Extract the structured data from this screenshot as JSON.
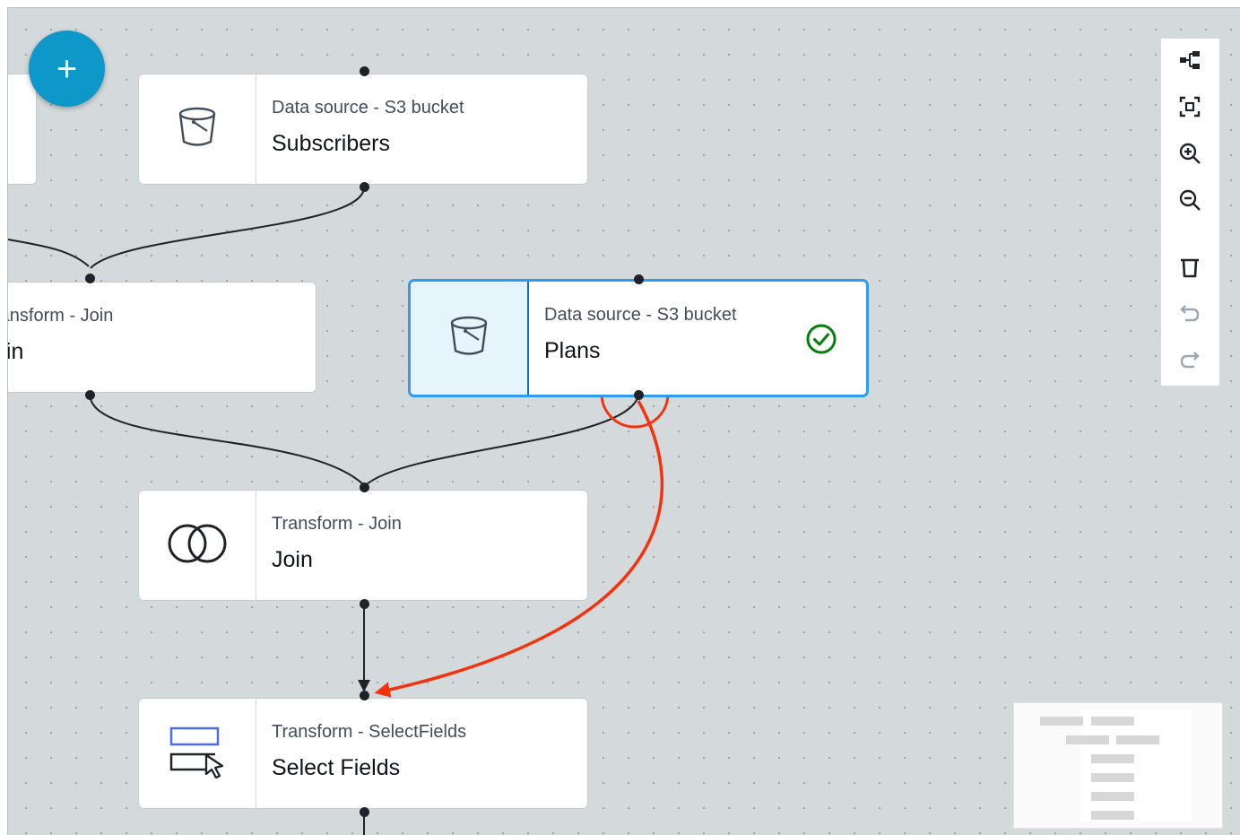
{
  "fab": {
    "label": "+"
  },
  "nodes": [
    {
      "type": "",
      "name": ""
    },
    {
      "type": "Data source - S3 bucket",
      "name": "Subscribers",
      "icon": "bucket-icon"
    },
    {
      "type": "ransform - Join",
      "name": "oin",
      "icon": "join-icon"
    },
    {
      "type": "Data source - S3 bucket",
      "name": "Plans",
      "icon": "bucket-icon",
      "status": "success"
    },
    {
      "type": "Transform - Join",
      "name": "Join",
      "icon": "join-icon"
    },
    {
      "type": "Transform - SelectFields",
      "name": "Select Fields",
      "icon": "select-fields-icon"
    }
  ],
  "toolbar": [
    "layout-icon",
    "fit-view-icon",
    "zoom-in-icon",
    "zoom-out-icon",
    "delete-icon",
    "undo-icon",
    "redo-icon"
  ],
  "colors": {
    "canvas": "#d4d9dc",
    "selected_border": "#2d9bf0",
    "annotation": "#f2330d",
    "fab": "#0e97c9",
    "success": "#037f0c"
  }
}
